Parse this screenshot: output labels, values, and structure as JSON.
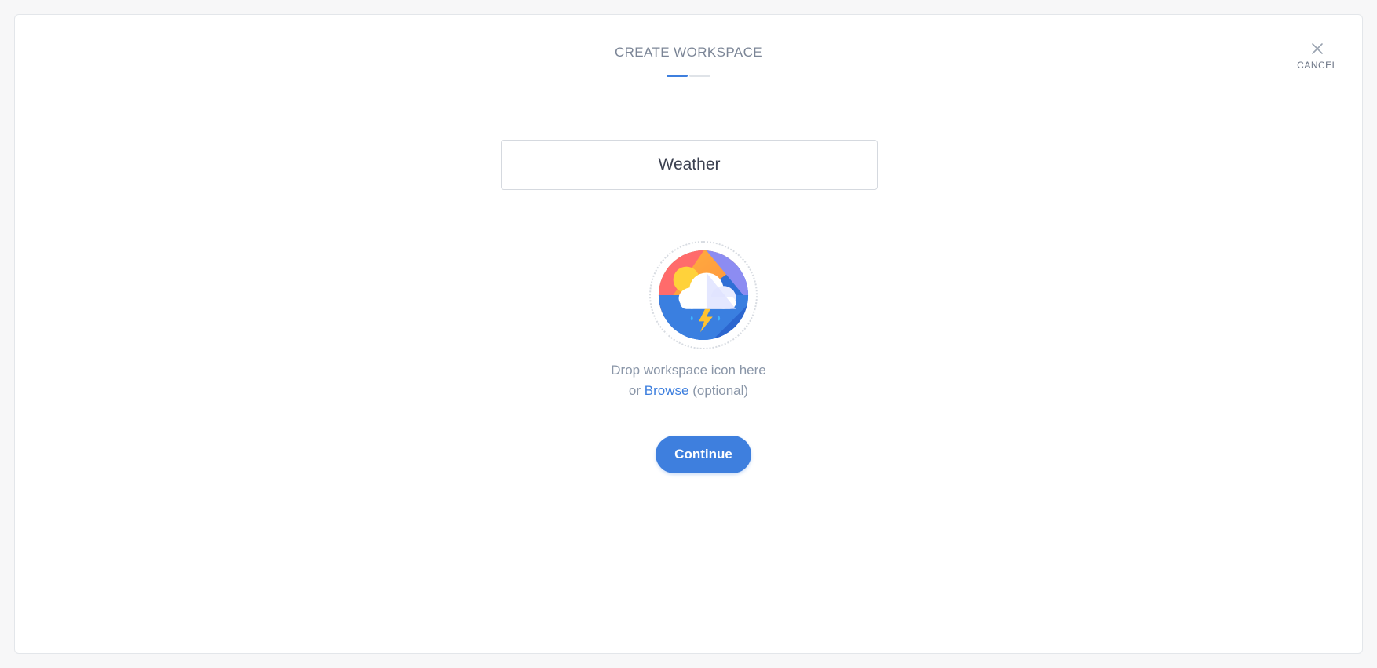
{
  "header": {
    "title": "CREATE WORKSPACE",
    "steps_total": 2,
    "step_current": 1
  },
  "cancel": {
    "label": "CANCEL",
    "icon": "close-icon"
  },
  "workspace_name": {
    "value": "Weather"
  },
  "icon_drop": {
    "icon": "weather-storm-icon",
    "line1": "Drop workspace icon here",
    "line2_prefix": "or",
    "browse_label": "Browse",
    "line2_suffix": "(optional)"
  },
  "continue_button": {
    "label": "Continue"
  },
  "colors": {
    "accent": "#3e7fde",
    "title_text": "#7b8596",
    "hint_text": "#8a96a8"
  }
}
